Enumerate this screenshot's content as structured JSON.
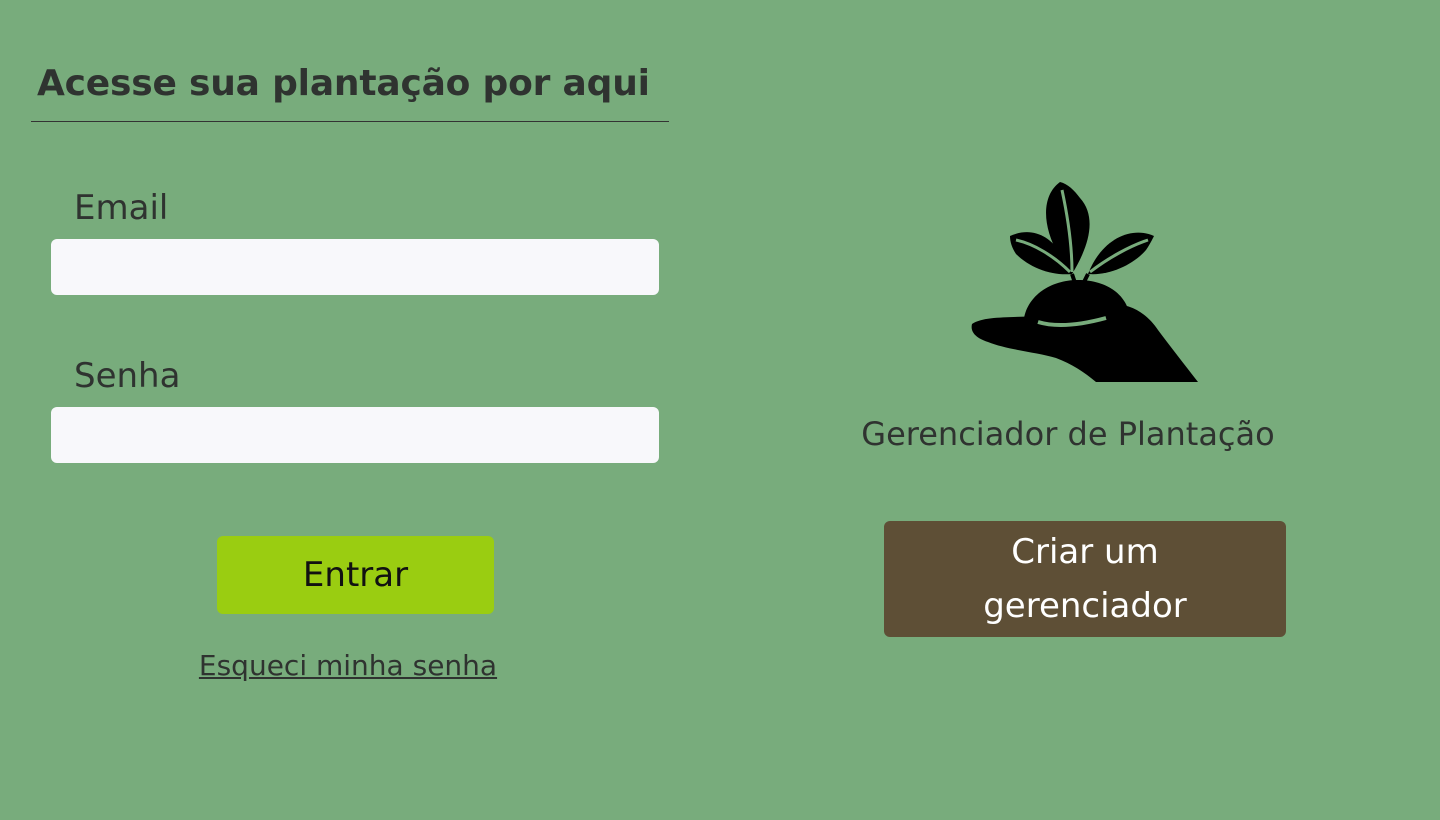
{
  "colors": {
    "background": "#78ac7c",
    "input_background": "#f8f8fb",
    "login_button": "#9acd11",
    "create_button": "#5e4f36",
    "text": "#2f3330"
  },
  "login": {
    "heading": "Acesse sua plantação por aqui",
    "email_label": "Email",
    "email_value": "",
    "password_label": "Senha",
    "password_value": "",
    "submit_label": "Entrar",
    "forgot_link": "Esqueci minha senha"
  },
  "brand": {
    "logo_icon": "hand-holding-plant-icon",
    "app_name": "Gerenciador de Plantação",
    "create_label": "Criar um gerenciador"
  }
}
